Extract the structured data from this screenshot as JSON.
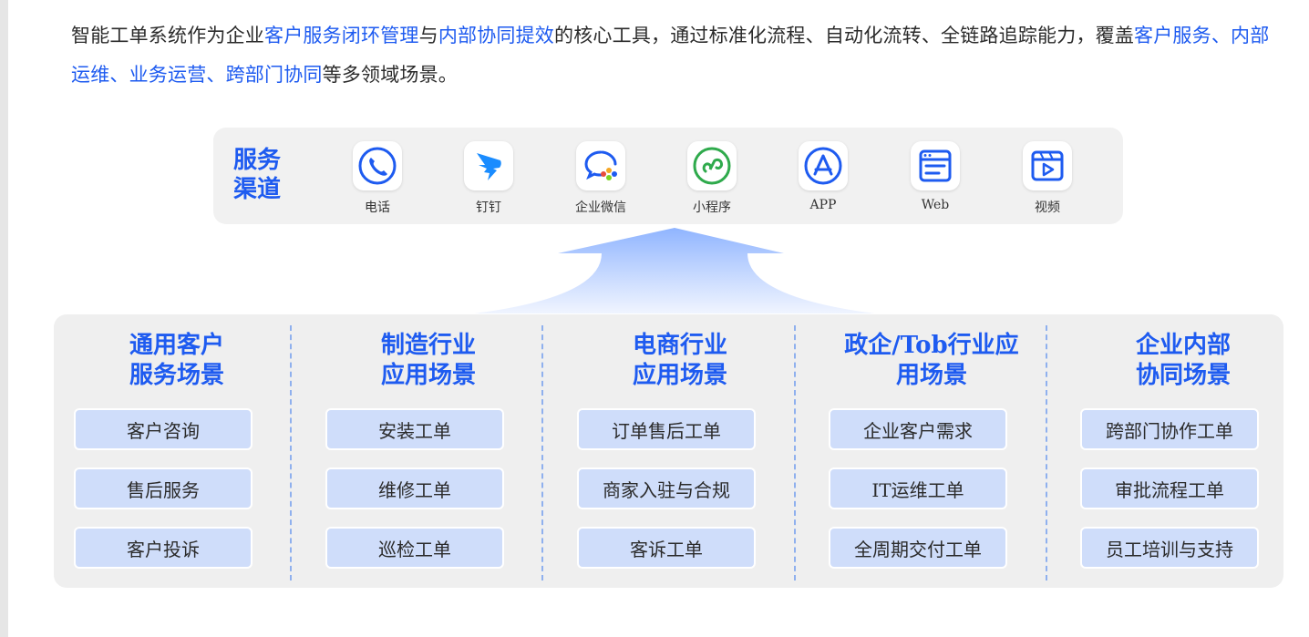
{
  "intro": {
    "parts": [
      {
        "text": "智能工单系统作为企业",
        "hl": false
      },
      {
        "text": "客户服务闭环管理",
        "hl": true
      },
      {
        "text": "与",
        "hl": false
      },
      {
        "text": "内部协同提效",
        "hl": true
      },
      {
        "text": "的核心工具，通过标准化流程、自动化流转、全链路追踪能力，覆盖",
        "hl": false
      },
      {
        "text": "客户服务、内部运维、业务运营、跨部门协同",
        "hl": true
      },
      {
        "text": "等多领域场景。",
        "hl": false
      }
    ]
  },
  "channels": {
    "title_line1": "服务",
    "title_line2": "渠道",
    "items": [
      {
        "label": "电话",
        "icon": "phone-icon"
      },
      {
        "label": "钉钉",
        "icon": "dingtalk-icon"
      },
      {
        "label": "企业微信",
        "icon": "wecom-icon"
      },
      {
        "label": "小程序",
        "icon": "miniprogram-icon"
      },
      {
        "label": "APP",
        "icon": "appstore-icon"
      },
      {
        "label": "Web",
        "icon": "web-icon"
      },
      {
        "label": "视频",
        "icon": "video-icon"
      }
    ]
  },
  "scenarios": [
    {
      "title_line1": "通用客户",
      "title_line2": "服务场景",
      "items": [
        "客户咨询",
        "售后服务",
        "客户投诉"
      ]
    },
    {
      "title_line1": "制造行业",
      "title_line2": "应用场景",
      "items": [
        "安装工单",
        "维修工单",
        "巡检工单"
      ]
    },
    {
      "title_line1": "电商行业",
      "title_line2": "应用场景",
      "items": [
        "订单售后工单",
        "商家入驻与合规",
        "客诉工单"
      ]
    },
    {
      "title_line1": "政企/Tob行业应",
      "title_line2": "用场景",
      "items": [
        "企业客户需求",
        "IT运维工单",
        "全周期交付工单"
      ]
    },
    {
      "title_line1": "企业内部",
      "title_line2": "协同场景",
      "items": [
        "跨部门协作工单",
        "审批流程工单",
        "员工培训与支持"
      ]
    }
  ],
  "colors": {
    "accent": "#1e5bf0",
    "pill": "#cfddfa",
    "panel": "#f1f1f1"
  }
}
